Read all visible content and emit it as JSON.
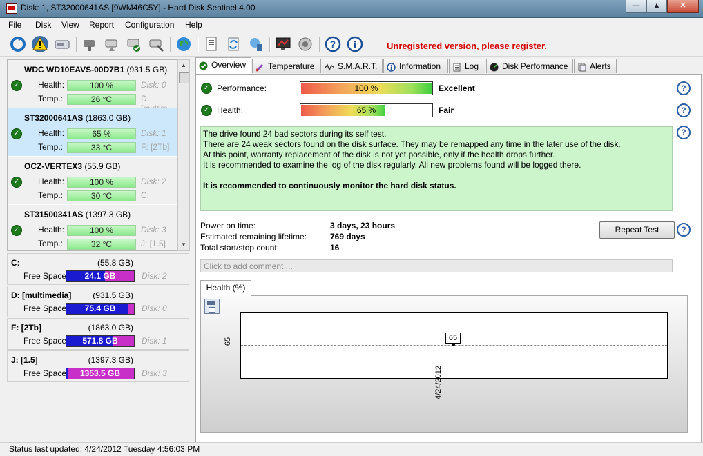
{
  "window": {
    "title": "Disk: 1, ST32000641AS [9WM46C5Y]  -  Hard Disk Sentinel 4.00",
    "controls": {
      "minimize": "—",
      "maximize": "▲",
      "close": "✕"
    }
  },
  "menu": [
    "File",
    "Disk",
    "View",
    "Report",
    "Configuration",
    "Help"
  ],
  "toolbar": {
    "icons": [
      "refresh-icon",
      "warning-icon",
      "drive-icon",
      "disk-tool-icon",
      "disk-check-icon",
      "disk-ok-icon",
      "disk-settings-icon",
      "globe-icon",
      "report-icon",
      "sync-icon",
      "network-icon",
      "monitor-icon",
      "speaker-icon",
      "help-icon",
      "info-icon"
    ],
    "register_text": "Unregistered version, please register."
  },
  "disks": [
    {
      "name": "WDC WD10EAVS-00D7B1",
      "size": "(931.5 GB)",
      "health": "100 %",
      "temp": "26 °C",
      "disk_label": "Disk: 0",
      "drive_label": "D: [multim"
    },
    {
      "name": "ST32000641AS",
      "size": "(1863.0 GB)",
      "health": "65 %",
      "temp": "33 °C",
      "disk_label": "Disk: 1",
      "drive_label": "F: [2Tb]"
    },
    {
      "name": "OCZ-VERTEX3",
      "size": "(55.9 GB)",
      "health": "100 %",
      "temp": "30 °C",
      "disk_label": "Disk: 2",
      "drive_label": "C:"
    },
    {
      "name": "ST31500341AS",
      "size": "(1397.3 GB)",
      "health": "100 %",
      "temp": "32 °C",
      "disk_label": "Disk: 3",
      "drive_label": "J: [1.5]"
    }
  ],
  "labels": {
    "health": "Health:",
    "temp": "Temp.:",
    "free_space": "Free Space"
  },
  "volumes": [
    {
      "name": "C:",
      "size": "(55.8 GB)",
      "free": "24.1 GB",
      "disk": "Disk: 2",
      "used_fraction": 0.57
    },
    {
      "name": "D: [multimedia]",
      "size": "(931.5 GB)",
      "free": "75.4 GB",
      "disk": "Disk: 0",
      "used_fraction": 0.92
    },
    {
      "name": "F: [2Tb]",
      "size": "(1863.0 GB)",
      "free": "571.8 GB",
      "disk": "Disk: 1",
      "used_fraction": 0.69
    },
    {
      "name": "J: [1.5]",
      "size": "(1397.3 GB)",
      "free": "1353.5 GB",
      "disk": "Disk: 3",
      "used_fraction": 0.03
    }
  ],
  "tabs": [
    "Overview",
    "Temperature",
    "S.M.A.R.T.",
    "Information",
    "Log",
    "Disk Performance",
    "Alerts"
  ],
  "overview": {
    "performance_label": "Performance:",
    "performance_value": "100 %",
    "performance_fraction": 1.0,
    "performance_rating": "Excellent",
    "health_label": "Health:",
    "health_value": "65 %",
    "health_fraction": 0.65,
    "health_rating": "Fair",
    "message_lines": [
      "The drive found 24 bad sectors during its self test.",
      "There are 24 weak sectors found on the disk surface. They may be remapped any time in the later use of the disk.",
      "At this point, warranty replacement of the disk is not yet possible, only if the health drops further.",
      "It is recommended to examine the log of the disk regularly. All new problems found will be logged there."
    ],
    "message_bold": "It is recommended to continuously monitor the hard disk status.",
    "power_on_label": "Power on time:",
    "power_on_value": "3 days, 23 hours",
    "lifetime_label": "Estimated remaining lifetime:",
    "lifetime_value": "769 days",
    "startstop_label": "Total start/stop count:",
    "startstop_value": "16",
    "repeat_button": "Repeat Test",
    "comment_placeholder": "Click to add comment ...",
    "chart_tab": "Health (%)"
  },
  "chart_data": {
    "type": "line",
    "x": [
      "4/24/2012"
    ],
    "series": [
      {
        "values": [
          65
        ]
      }
    ],
    "y_tick_labels": [
      "65"
    ],
    "point_labels": [
      "65"
    ]
  },
  "status": "Status last updated: 4/24/2012 Tuesday 4:56:03 PM"
}
